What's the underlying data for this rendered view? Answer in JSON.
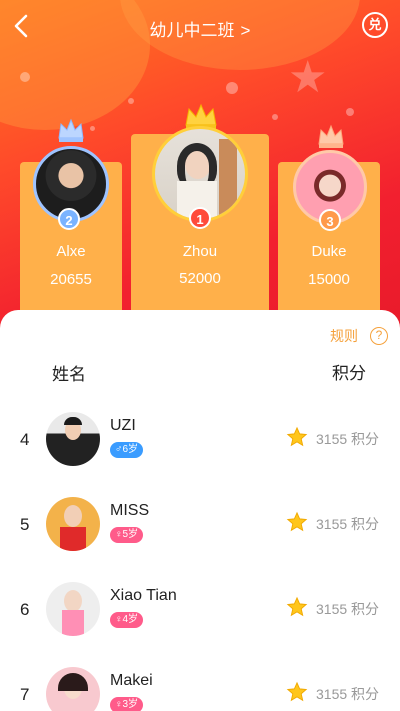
{
  "header": {
    "title": "幼儿中二班",
    "title_chevron": ">",
    "back_icon": "chevron-left-icon",
    "redeem_label": "兑"
  },
  "podium": [
    {
      "rank": "2",
      "name": "Alxe",
      "score": "20655",
      "badge_color": "#7ab3ff"
    },
    {
      "rank": "1",
      "name": "Zhou",
      "score": "52000",
      "badge_color": "#ff4b3a"
    },
    {
      "rank": "3",
      "name": "Duke",
      "score": "15000",
      "badge_color": "#ff9a4a"
    }
  ],
  "table": {
    "rules_label": "规则",
    "rules_help": "?",
    "col_name": "姓名",
    "col_score": "积分",
    "rows": [
      {
        "rank": "4",
        "name": "UZI",
        "tag": "♂6岁",
        "score": "3155 积分"
      },
      {
        "rank": "5",
        "name": "MISS",
        "tag": "♀5岁",
        "score": "3155 积分"
      },
      {
        "rank": "6",
        "name": "Xiao Tian",
        "tag": "♀4岁",
        "score": "3155 积分"
      },
      {
        "rank": "7",
        "name": "Makei",
        "tag": "♀3岁",
        "score": "3155 积分"
      }
    ]
  },
  "colors": {
    "accent": "#f5a13b",
    "podium": "#ffb04a",
    "male_tag": "#3a9cff",
    "female_tag": "#ff5b8a"
  }
}
